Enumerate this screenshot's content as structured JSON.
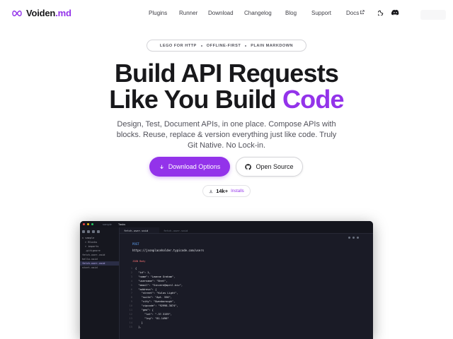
{
  "brand": {
    "name": "Voiden",
    "ext": ".md"
  },
  "nav": {
    "links": [
      "Plugins",
      "Runner",
      "Download",
      "Changelog",
      "Blog",
      "Support",
      "Docs"
    ],
    "icons": [
      "moon-icon",
      "discord-icon",
      "external-link-icon"
    ]
  },
  "tags": [
    "LEGO FOR HTTP",
    "OFFLINE-FIRST",
    "PLAIN MARKDOWN"
  ],
  "hero": {
    "line1": "Build API Requests",
    "line2_start": "Like You Build ",
    "line2_accent": "Code",
    "subtitle": "Design, Test, Document APIs, in one place. Compose APIs with blocks. Reuse, replace & version everything just like code. Truly Git Native. No Lock-in."
  },
  "buttons": {
    "primary": "Download Options",
    "secondary": "Open Source"
  },
  "installs": {
    "count": "14k+",
    "label": "Installs"
  },
  "colors": {
    "accent": "#9333ea",
    "text": "#18181b",
    "muted": "#52525b"
  },
  "app": {
    "titlebar": {
      "left": "sample",
      "right": "Tasks"
    },
    "sidebar_items": [
      "v sample",
      "> Blocks",
      "> imports",
      ".gitignore",
      "fetch-user.void",
      "hello.void",
      "fetch-user.void",
      "start.void"
    ],
    "tabs": [
      "fetch-user.void",
      "fetch-user.void"
    ],
    "method": "POST",
    "url": "https://jsonplaceholder.typicode.com/users",
    "json_label": "JSON Body",
    "json_lines": [
      {
        "n": "1",
        "t": "{"
      },
      {
        "n": "2",
        "t": "  \"id\": 1,"
      },
      {
        "n": "3",
        "t": "  \"name\": \"Leanne Graham\","
      },
      {
        "n": "4",
        "t": "  \"username\": \"Bret\","
      },
      {
        "n": "5",
        "t": "  \"email\": \"Sincere@april.biz\","
      },
      {
        "n": "6",
        "t": "  \"address\": {"
      },
      {
        "n": "7",
        "t": "    \"street\": \"Kulas Light\","
      },
      {
        "n": "8",
        "t": "    \"suite\": \"Apt. 556\","
      },
      {
        "n": "9",
        "t": "    \"city\": \"Gwenborough\","
      },
      {
        "n": "10",
        "t": "    \"zipcode\": \"92998-3874\","
      },
      {
        "n": "11",
        "t": "    \"geo\": {"
      },
      {
        "n": "12",
        "t": "      \"lat\": \"-37.3159\","
      },
      {
        "n": "13",
        "t": "      \"lng\": \"81.1496\""
      },
      {
        "n": "14",
        "t": "    }"
      },
      {
        "n": "15",
        "t": "  },"
      }
    ]
  }
}
